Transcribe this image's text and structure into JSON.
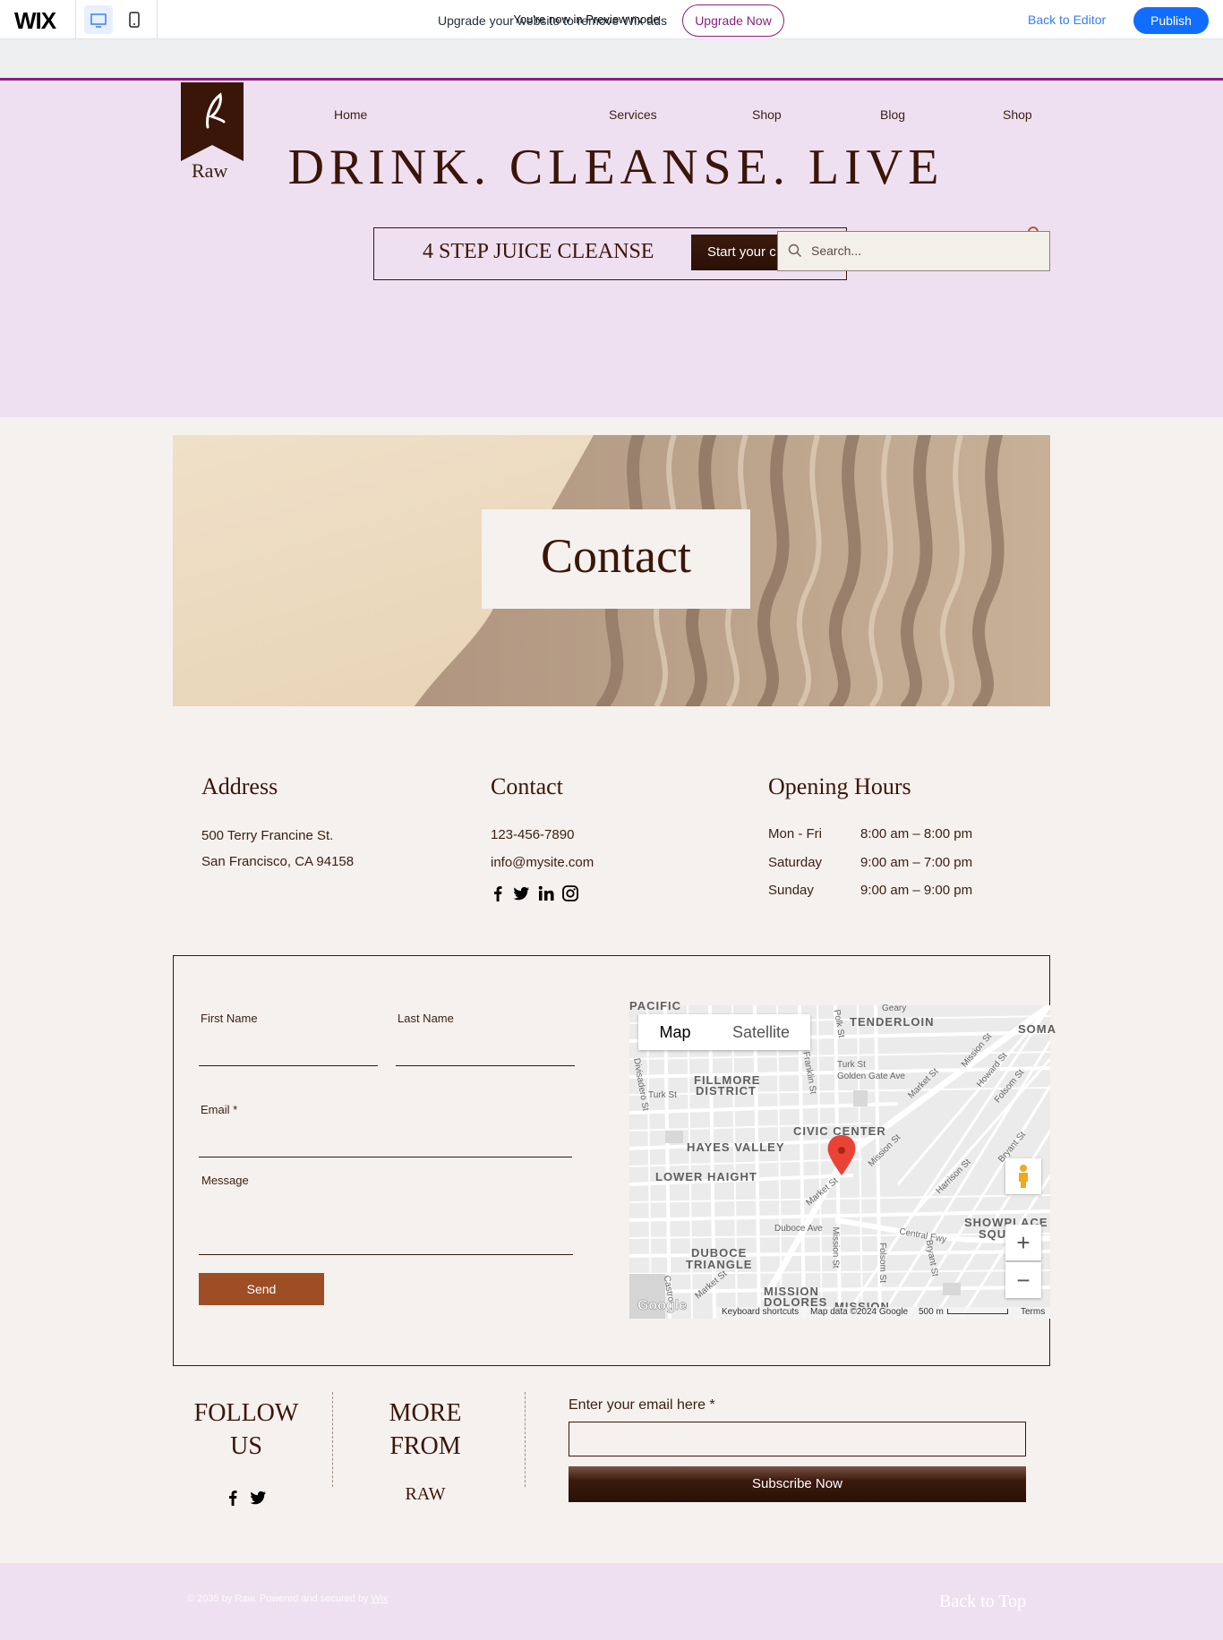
{
  "wixbar": {
    "logo": "WIX",
    "preview_text": "You're now in Preview mode",
    "back_to_editor": "Back to Editor",
    "publish": "Publish"
  },
  "ads": {
    "text": "Upgrade your website to remove Wix ads",
    "button": "Upgrade Now"
  },
  "header": {
    "logo_text": "Raw",
    "nav": [
      "Home",
      "Services",
      "Shop",
      "Blog",
      "Shop"
    ],
    "tagline": "DRINK. CLEANSE. LIVE",
    "promo_text": "4 STEP JUICE CLEANSE",
    "promo_button": "Start your c",
    "search_placeholder": "Search..."
  },
  "hero": {
    "title": "Contact"
  },
  "address": {
    "heading": "Address",
    "line1": "500 Terry Francine St.",
    "line2": "San Francisco, CA 94158"
  },
  "contact": {
    "heading": "Contact",
    "phone": "123-456-7890",
    "email": "info@mysite.com",
    "social": [
      "facebook-icon",
      "twitter-icon",
      "linkedin-icon",
      "instagram-icon"
    ]
  },
  "hours": {
    "heading": "Opening Hours",
    "rows": [
      {
        "day": "Mon - Fri",
        "time": "8:00 am – 8:00 pm"
      },
      {
        "day": "Saturday",
        "time": "9:00 am – 7:00 pm"
      },
      {
        "day": "Sunday",
        "time": "9:00 am – 9:00 pm"
      }
    ]
  },
  "form": {
    "first_name": "First Name",
    "last_name": "Last Name",
    "email": "Email *",
    "message": "Message",
    "send": "Send"
  },
  "map": {
    "tab_map": "Map",
    "tab_satellite": "Satellite",
    "labels": {
      "pacific": "PACIFIC",
      "tenderloin": "TENDERLOIN",
      "soma": "SOMA",
      "fillmore": "FILLMORE",
      "district": "DISTRICT",
      "civic_center": "CIVIC CENTER",
      "hayes_valley": "HAYES VALLEY",
      "lower_haight": "LOWER HAIGHT",
      "showplace": "SHOWPLACE",
      "squ": "SQU",
      "duboce": "DUBOCE",
      "triangle": "TRIANGLE",
      "mission": "MISSION",
      "dolores": "DOLORES",
      "mission2": "MISSION"
    },
    "streets": {
      "turk": "Turk St",
      "turk2": "Turk St",
      "golden_gate": "Golden Gate Ave",
      "market": "Market St",
      "market2": "Market St",
      "market3": "Market St",
      "mission_st": "Mission St",
      "mission_st2": "Mission St",
      "mission_st3": "Mission St",
      "howard": "Howard St",
      "folsom": "Folsom St",
      "folsom2": "Folsom St",
      "harrison": "Harrison St",
      "bryant": "Bryant St",
      "bryant2": "Bryant St",
      "duboce": "Duboce Ave",
      "central": "Central Fwy",
      "divisadero": "Divisadero St",
      "polk": "Polk St",
      "geary": "Geary",
      "franklin": "Franklin St",
      "castro": "Castro"
    },
    "google": "Google",
    "keyboard": "Keyboard shortcuts",
    "map_data": "Map data ©2024 Google",
    "scale": "500 m",
    "terms": "Terms"
  },
  "follow": {
    "title": "FOLLOW US",
    "more_title": "MORE FROM",
    "raw": "RAW"
  },
  "subscribe": {
    "label": "Enter your email here *",
    "button": "Subscribe Now"
  },
  "footer": {
    "copyright": "© 2035 by Raw. Powered and secured by ",
    "wix_link": "Wix",
    "back_to_top": "Back to Top"
  },
  "colors": {
    "brand_dark": "#3a1609",
    "header_bg": "#efe0f1",
    "page_bg": "#f5f1ee",
    "send_button": "#9e4d24",
    "publish": "#116dff"
  }
}
